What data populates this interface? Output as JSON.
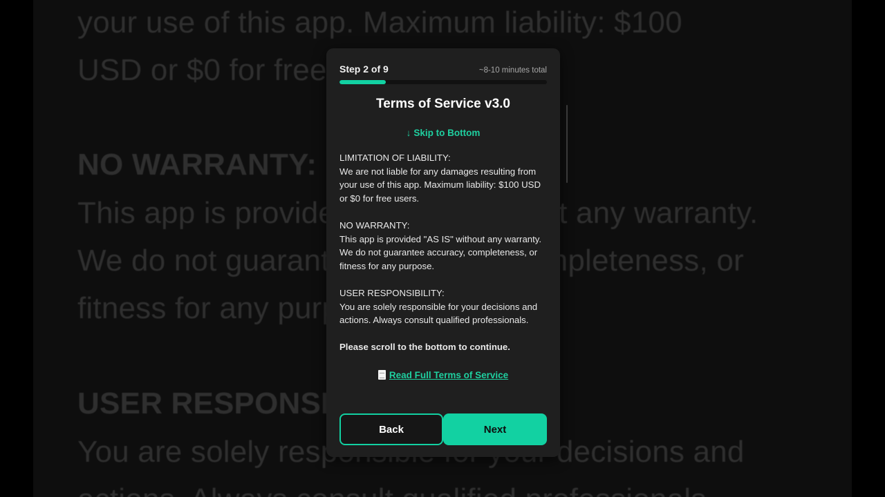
{
  "background": {
    "lines": [
      "your use of this app. Maximum liability: $100",
      "USD or $0 for free users.",
      "NO WARRANTY:",
      "This app is provided \"AS IS\" without any warranty.",
      "We do not guarantee accuracy, completeness, or",
      "fitness for any purpose.",
      "USER RESPONSIBILITY:",
      "You are solely responsible for your decisions and",
      "actions. Always consult qualified professionals."
    ]
  },
  "modal": {
    "step_label": "Step 2 of 9",
    "time_estimate": "~8-10 minutes total",
    "progress_fraction": 0.222,
    "title": "Terms of Service v3.0",
    "skip_label": "Skip to Bottom",
    "skip_icon": "arrow-down-icon",
    "sections": [
      {
        "heading": "LIMITATION OF LIABILITY:",
        "body": "We are not liable for any damages resulting from your use of this app. Maximum liability: $100 USD or $0 for free users."
      },
      {
        "heading": "NO WARRANTY:",
        "body": "This app is provided \"AS IS\" without any warranty. We do not guarantee accuracy, completeness, or fitness for any purpose."
      },
      {
        "heading": "USER RESPONSIBILITY:",
        "body": "You are solely responsible for your decisions and actions. Always consult qualified professionals."
      }
    ],
    "scroll_notice": "Please scroll to the bottom to continue.",
    "full_terms_icon": "document-icon",
    "full_terms_label": "Read Full Terms of Service",
    "back_label": "Back",
    "next_label": "Next"
  },
  "colors": {
    "accent": "#12d1a2",
    "card_bg": "#1f1f1f",
    "text": "#e9e9e9"
  }
}
